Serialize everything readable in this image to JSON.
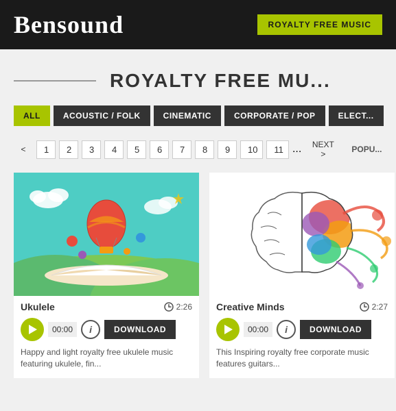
{
  "header": {
    "logo": "Bensound",
    "royalty_btn": "ROYALTY FREE MUSIC"
  },
  "page_title": "ROYALTY FREE MU...",
  "page_title_full": "ROYALTY FREE MUSIC",
  "divider_line": "——————————",
  "filters": {
    "all_label": "ALL",
    "tabs": [
      {
        "label": "ACOUSTIC / FOLK",
        "active": false
      },
      {
        "label": "CINEMATIC",
        "active": false
      },
      {
        "label": "CORPORATE / POP",
        "active": false
      },
      {
        "label": "ELECT...",
        "active": false
      }
    ]
  },
  "pagination": {
    "prev": "<",
    "pages": [
      "1",
      "2",
      "3",
      "4",
      "5",
      "6",
      "7",
      "8",
      "9",
      "10",
      "11"
    ],
    "ellipsis": "...",
    "next": "NEXT >",
    "popular": "POPU..."
  },
  "tracks": [
    {
      "title": "Ukulele",
      "duration": "2:26",
      "time_display": "00:00",
      "download_label": "DOWNLOAD",
      "description": "Happy and light royalty free ukulele music featuring ukulele, fin..."
    },
    {
      "title": "Creative Minds",
      "duration": "2:27",
      "time_display": "00:00",
      "download_label": "DOWNLOAD",
      "description": "This Inspiring royalty free corporate music features guitars..."
    }
  ]
}
